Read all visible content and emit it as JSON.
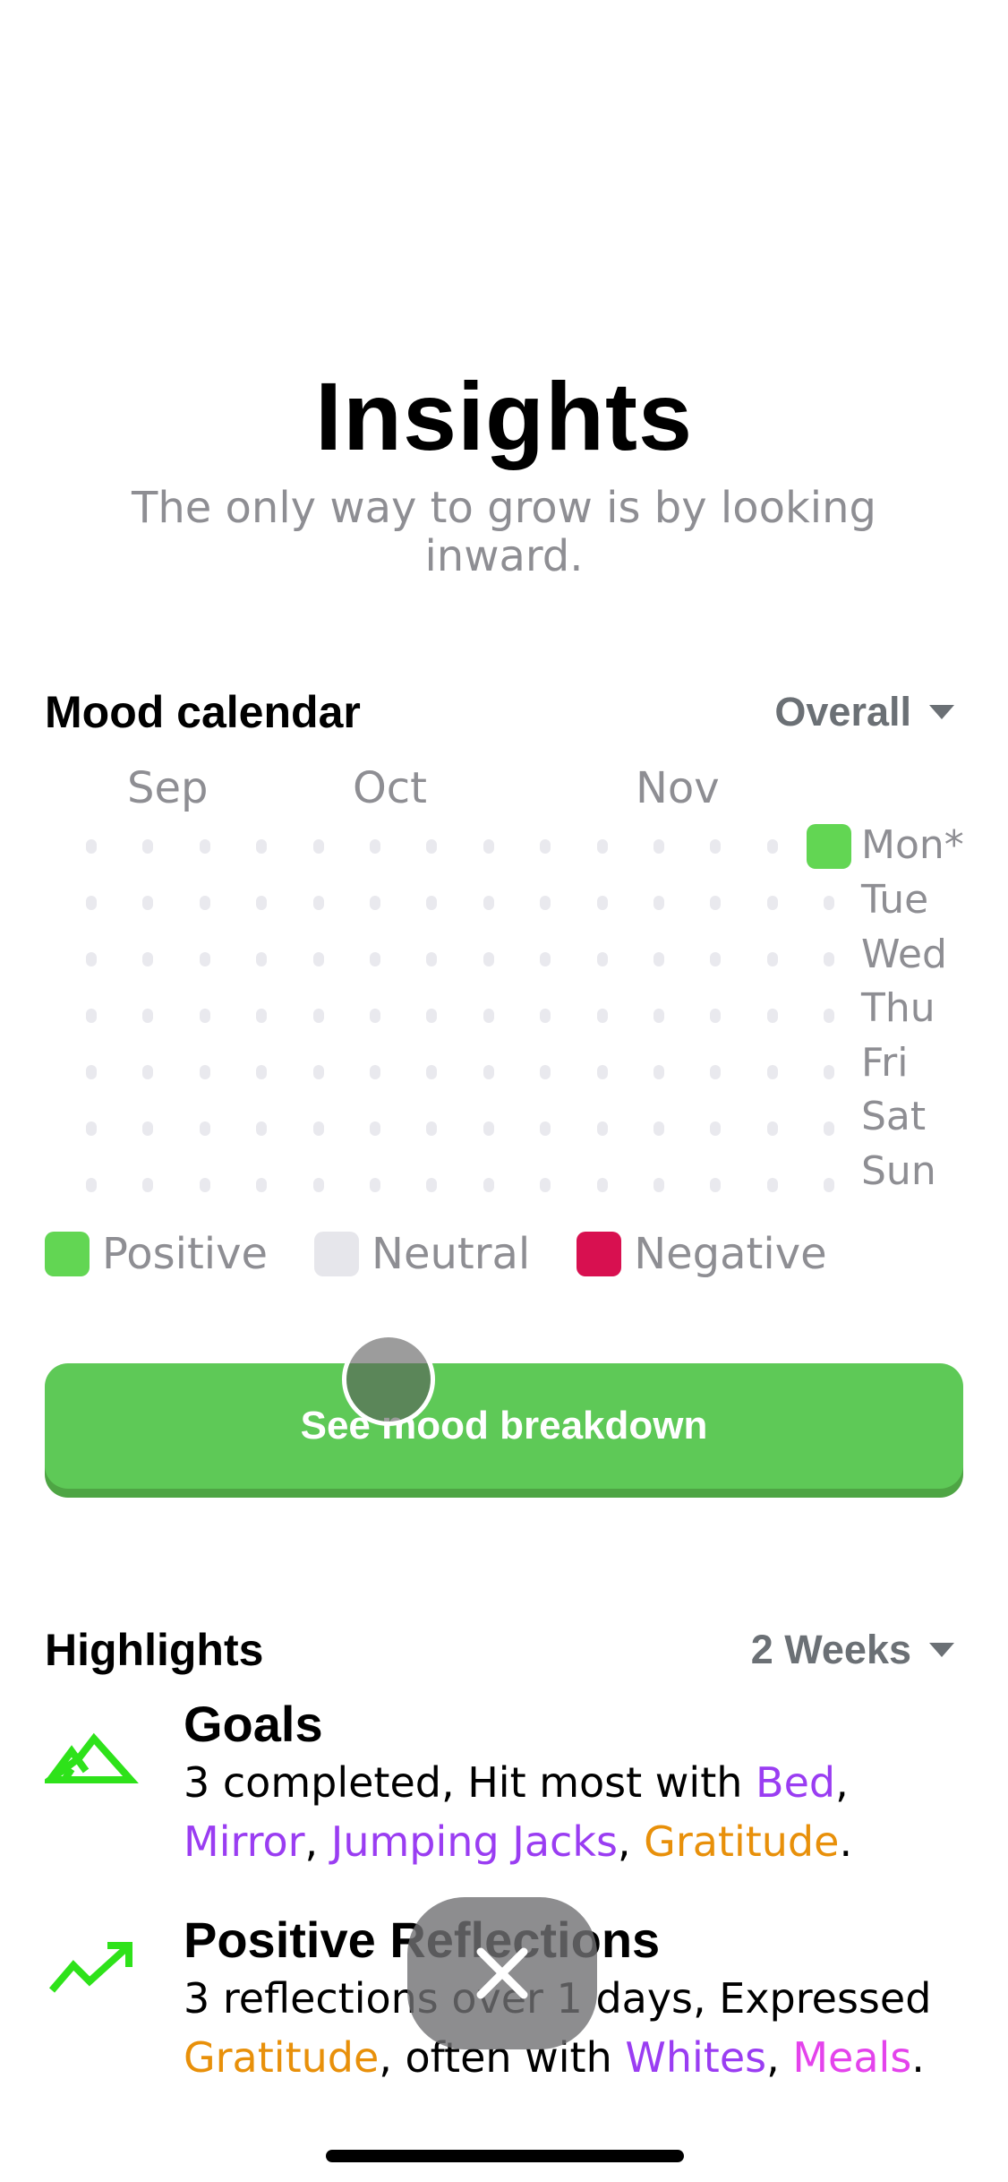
{
  "header": {
    "title": "Insights",
    "subtitle": "The only way to grow is by looking inward."
  },
  "mood_calendar": {
    "title": "Mood calendar",
    "filter": "Overall",
    "months": [
      "Sep",
      "Oct",
      "Nov"
    ],
    "weekdays": [
      "Mon*",
      "Tue",
      "Wed",
      "Thu",
      "Fri",
      "Sat",
      "Sun"
    ],
    "weeks": 14,
    "entries": [
      {
        "week": 14,
        "day": "Mon",
        "mood": "positive"
      }
    ],
    "legend": [
      {
        "key": "positive",
        "label": "Positive",
        "color": "#62d653"
      },
      {
        "key": "neutral",
        "label": "Neutral",
        "color": "#e6e6eb"
      },
      {
        "key": "negative",
        "label": "Negative",
        "color": "#d81050"
      }
    ],
    "cta_label": "See mood breakdown"
  },
  "highlights": {
    "title": "Highlights",
    "filter": "2 Weeks",
    "items": [
      {
        "icon": "mountain-icon",
        "title": "Goals",
        "segments": [
          {
            "text": "3 completed, Hit most with "
          },
          {
            "text": "Bed",
            "color": "purple"
          },
          {
            "text": ", "
          },
          {
            "text": "Mirror",
            "color": "purple"
          },
          {
            "text": ", "
          },
          {
            "text": "Jumping Jacks",
            "color": "purple"
          },
          {
            "text": ", "
          },
          {
            "text": "Gratitude",
            "color": "orange"
          },
          {
            "text": "."
          }
        ]
      },
      {
        "icon": "trending-up-icon",
        "title": "Positive Reflections",
        "segments": [
          {
            "text": "3 reflections over 1 days, Expressed "
          },
          {
            "text": "Gratitude",
            "color": "orange"
          },
          {
            "text": ", often with "
          },
          {
            "text": "Whites",
            "color": "purple"
          },
          {
            "text": ", "
          },
          {
            "text": "Meals",
            "color": "pink"
          },
          {
            "text": "."
          }
        ]
      }
    ]
  },
  "colors": {
    "accent_green": "#5ec957",
    "icon_green": "#2ee21a",
    "purple": "#9a3df2",
    "orange": "#e8900a",
    "pink": "#e443ec"
  }
}
